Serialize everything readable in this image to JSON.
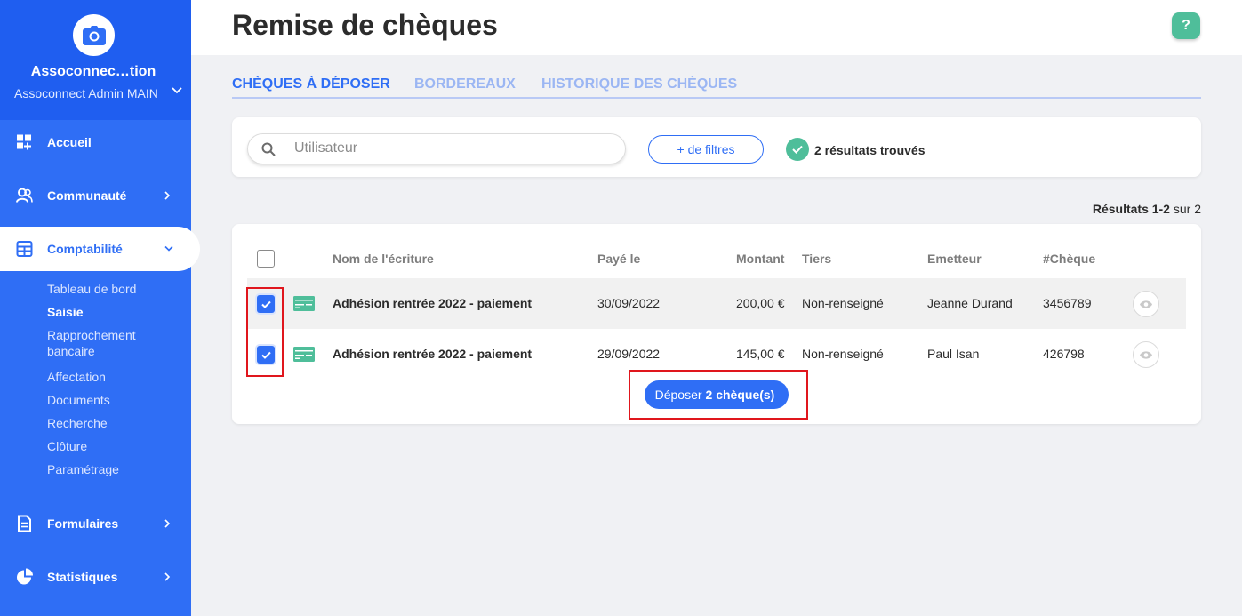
{
  "sidebar": {
    "org_name": "Assoconnec…tion",
    "org_sub": "Assoconnect Admin MAIN",
    "items": [
      {
        "label": "Accueil",
        "icon": "dashboard-icon"
      },
      {
        "label": "Communauté",
        "icon": "community-icon"
      },
      {
        "label": "Comptabilité",
        "icon": "calculator-icon"
      },
      {
        "label": "Formulaires",
        "icon": "form-icon"
      },
      {
        "label": "Statistiques",
        "icon": "pie-chart-icon"
      }
    ],
    "subitems": [
      "Tableau de bord",
      "Saisie",
      "Rapprochement bancaire",
      "Affectation",
      "Documents",
      "Recherche",
      "Clôture",
      "Paramétrage"
    ]
  },
  "header": {
    "title": "Remise de chèques",
    "help": "?"
  },
  "tabs": [
    "CHÈQUES À DÉPOSER",
    "BORDEREAUX",
    "HISTORIQUE DES CHÈQUES"
  ],
  "filters": {
    "search_placeholder": "Utilisateur",
    "more_filters": "+ de filtres",
    "results_found": "2 résultats trouvés"
  },
  "results_range": {
    "bold": "Résultats 1-2",
    "rest": " sur 2"
  },
  "table": {
    "headers": [
      "Nom de l'écriture",
      "Payé le",
      "Montant",
      "Tiers",
      "Emetteur",
      "#Chèque"
    ],
    "rows": [
      {
        "name": "Adhésion rentrée 2022 - paiement",
        "date": "30/09/2022",
        "amount": "200,00 €",
        "tiers": "Non-renseigné",
        "emetteur": "Jeanne Durand",
        "cheque": "3456789",
        "checked": true
      },
      {
        "name": "Adhésion rentrée 2022 - paiement",
        "date": "29/09/2022",
        "amount": "145,00 €",
        "tiers": "Non-renseigné",
        "emetteur": "Paul Isan",
        "cheque": "426798",
        "checked": true
      }
    ]
  },
  "deposit_button": {
    "prefix": "Déposer",
    "bold": "2 chèque(s)"
  },
  "colors": {
    "primary": "#2f6ef5",
    "accent_green": "#4fbe9a",
    "highlight": "#e0161d"
  }
}
